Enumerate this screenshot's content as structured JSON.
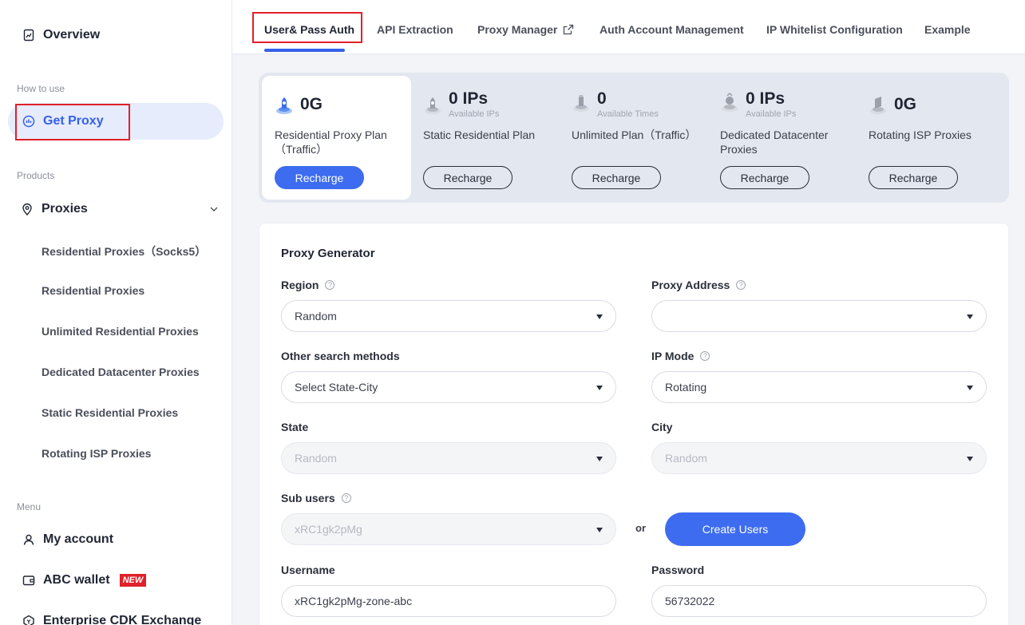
{
  "sidebar": {
    "overview": "Overview",
    "how_to_use_label": "How to use",
    "get_proxy": "Get Proxy",
    "products_label": "Products",
    "proxies": "Proxies",
    "sub_items": [
      "Residential Proxies（Socks5）",
      "Residential Proxies",
      "Unlimited Residential Proxies",
      "Dedicated Datacenter Proxies",
      "Static Residential Proxies",
      "Rotating ISP Proxies"
    ],
    "menu_label": "Menu",
    "my_account": "My account",
    "wallet": "ABC wallet",
    "new_badge": "NEW",
    "cdk": "Enterprise CDK Exchange"
  },
  "tabs": [
    "User& Pass Auth",
    "API Extraction",
    "Proxy Manager",
    "Auth Account Management",
    "IP Whitelist Configuration",
    "Example"
  ],
  "plans": [
    {
      "value": "0G",
      "sub": "",
      "name": "Residential Proxy Plan（Traffic）",
      "button": "Recharge"
    },
    {
      "value": "0 IPs",
      "sub": "Available IPs",
      "name": "Static Residential Plan",
      "button": "Recharge"
    },
    {
      "value": "0",
      "sub": "Available Times",
      "name": "Unlimited Plan（Traffic）",
      "button": "Recharge"
    },
    {
      "value": "0 IPs",
      "sub": "Available IPs",
      "name": "Dedicated Datacenter Proxies",
      "button": "Recharge"
    },
    {
      "value": "0G",
      "sub": "",
      "name": "Rotating ISP Proxies",
      "button": "Recharge"
    }
  ],
  "generator": {
    "title": "Proxy Generator",
    "region_label": "Region",
    "region_value": "Random",
    "proxy_address_label": "Proxy Address",
    "proxy_address_value": "",
    "other_methods_label": "Other search methods",
    "other_methods_value": "Select State-City",
    "ip_mode_label": "IP Mode",
    "ip_mode_value": "Rotating",
    "state_label": "State",
    "state_value": "Random",
    "city_label": "City",
    "city_value": "Random",
    "sub_users_label": "Sub users",
    "sub_users_value": "xRC1gk2pMg",
    "or_text": "or",
    "create_users": "Create Users",
    "username_label": "Username",
    "username_value": "xRC1gk2pMg-zone-abc",
    "password_label": "Password",
    "password_value": "56732022"
  },
  "colors": {
    "accent": "#3d6cf0",
    "highlight_box": "#e0202a",
    "nav_active_bg": "#e6ecfb"
  }
}
